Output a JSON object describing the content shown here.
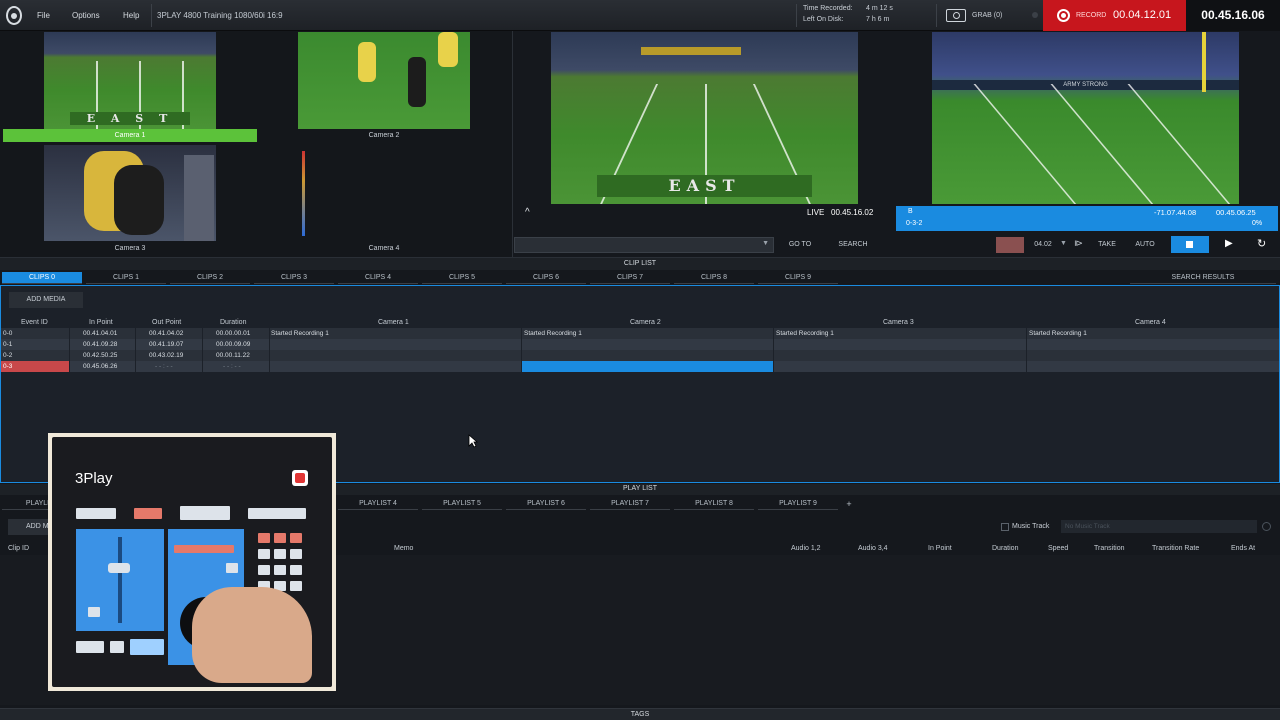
{
  "topbar": {
    "menu": [
      "File",
      "Options",
      "Help"
    ],
    "project": "3PLAY 4800 Training 1080/60i 16:9",
    "time_recorded_label": "Time Recorded:",
    "time_recorded_value": "4 m 12 s",
    "left_on_disk_label": "Left On Disk:",
    "left_on_disk_value": "7 h 6 m",
    "grab_label": "GRAB (0)",
    "record_label": "RECORD",
    "record_time": "00.04.12.01",
    "clock": "00.45.16.06"
  },
  "multiview": {
    "cameras": [
      "Camera 1",
      "Camera 2",
      "Camera 3",
      "Camera 4"
    ]
  },
  "preview": {
    "field_text": "EAST",
    "live_label": "LIVE",
    "live_time": "00.45.16.02",
    "caret": "^"
  },
  "program": {
    "field_text": "ARMY STRONG",
    "marker_b": "B",
    "clip_id": "0-3-2",
    "timecode_left": "-71.07.44.08",
    "timecode_right": "00.45.06.25",
    "percent": "0%"
  },
  "transport": {
    "goto": "GO TO",
    "search": "SEARCH",
    "speed": "04.02",
    "take": "TAKE",
    "auto": "AUTO"
  },
  "clip_list": {
    "title": "CLIP LIST",
    "tabs": [
      "CLIPS 0",
      "CLIPS 1",
      "CLIPS 2",
      "CLIPS 3",
      "CLIPS 4",
      "CLIPS 5",
      "CLIPS 6",
      "CLIPS 7",
      "CLIPS 8",
      "CLIPS 9"
    ],
    "search_results": "SEARCH RESULTS",
    "add_media": "ADD MEDIA",
    "columns": [
      "Event ID",
      "In Point",
      "Out Point",
      "Duration",
      "Camera 1",
      "Camera 2",
      "Camera 3",
      "Camera 4"
    ],
    "rows": [
      {
        "id": "0-0",
        "in": "00.41.04.01",
        "out": "00.41.04.02",
        "dur": "00.00.00.01",
        "cam1": "Started Recording 1",
        "cam2": "Started Recording 1",
        "cam3": "Started Recording 1",
        "cam4": "Started Recording 1"
      },
      {
        "id": "0-1",
        "in": "00.41.09.28",
        "out": "00.41.19.07",
        "dur": "00.00.09.09",
        "cam1": "",
        "cam2": "",
        "cam3": "",
        "cam4": ""
      },
      {
        "id": "0-2",
        "in": "00.42.50.25",
        "out": "00.43.02.19",
        "dur": "00.00.11.22",
        "cam1": "",
        "cam2": "",
        "cam3": "",
        "cam4": ""
      },
      {
        "id": "0-3",
        "in": "00.45.06.26",
        "out": "- - : - -",
        "dur": "- - : - -",
        "cam1": "",
        "cam2": "",
        "cam3": "",
        "cam4": ""
      }
    ]
  },
  "play_list": {
    "title": "PLAY LIST",
    "tabs": [
      "PLAYLIST",
      "PLAYLIST 4",
      "PLAYLIST 5",
      "PLAYLIST 6",
      "PLAYLIST 7",
      "PLAYLIST 8",
      "PLAYLIST 9"
    ],
    "add_label": "+",
    "add_media": "ADD M",
    "music_track": "Music Track",
    "music_placeholder": "No Music Track",
    "columns": [
      "Clip ID",
      "Memo",
      "Audio 1,2",
      "Audio 3,4",
      "In Point",
      "Duration",
      "Speed",
      "Transition",
      "Transition Rate",
      "Ends At"
    ]
  },
  "controller": {
    "brand": "3Play"
  },
  "footer": {
    "tags": "TAGS"
  },
  "colors": {
    "accent_blue": "#1a8be0",
    "record_red": "#c7161d",
    "camera_green": "#5cc23a"
  }
}
